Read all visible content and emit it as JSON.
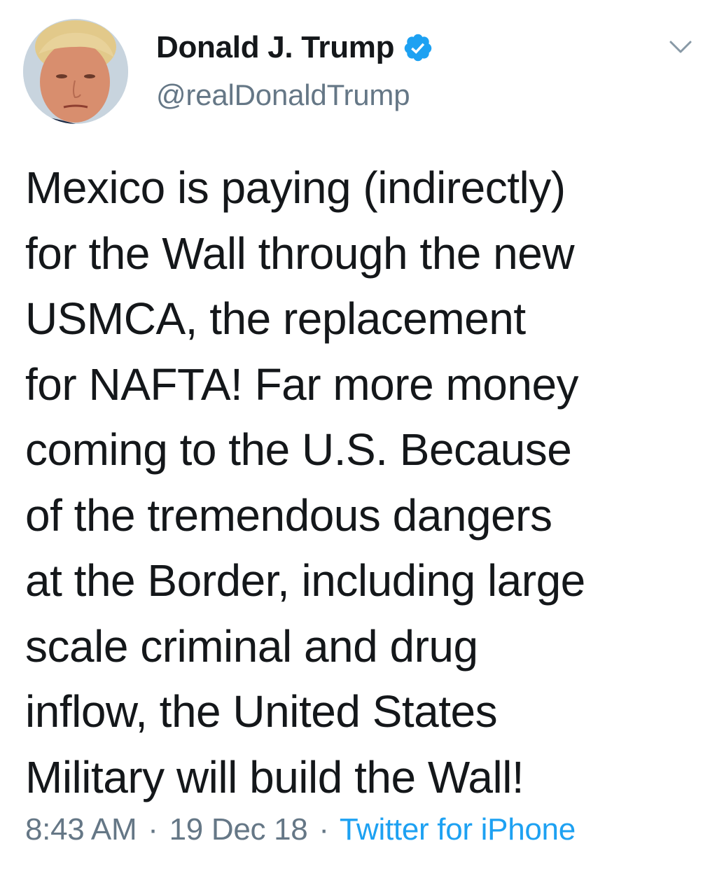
{
  "tweet": {
    "author": {
      "display_name": "Donald J. Trump",
      "handle": "@realDonaldTrump",
      "verified_icon": "verified-badge-icon"
    },
    "text_lines": [
      "Mexico is paying (indirectly)",
      "for the Wall through the new",
      "USMCA, the replacement",
      "for NAFTA! Far more money",
      "coming to the U.S. Because",
      "of the tremendous dangers",
      "at the Border, including large",
      "scale criminal and drug",
      "inflow, the United States",
      "Military will build the Wall!"
    ],
    "time": "8:43 AM",
    "separator": "·",
    "date": "19 Dec 18",
    "source": "Twitter for iPhone"
  },
  "colors": {
    "text": "#14171a",
    "secondary": "#657786",
    "accent": "#1da1f2",
    "background": "#ffffff"
  }
}
